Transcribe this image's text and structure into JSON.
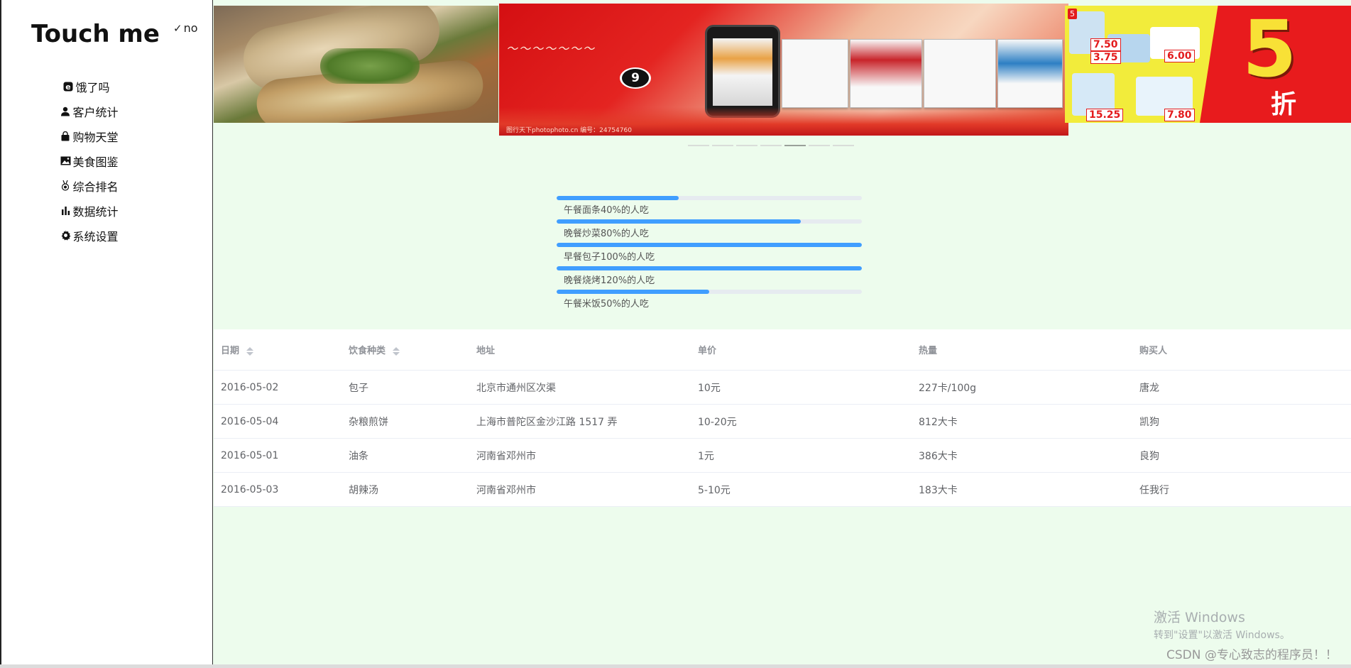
{
  "sidebar": {
    "title": "Touch me",
    "toggle_label": "no",
    "items": [
      {
        "label": "饿了吗",
        "icon": "eleme-icon"
      },
      {
        "label": "客户统计",
        "icon": "user-icon"
      },
      {
        "label": "购物天堂",
        "icon": "shopping-bag-icon"
      },
      {
        "label": "美食图鉴",
        "icon": "picture-icon"
      },
      {
        "label": "综合排名",
        "icon": "medal-icon"
      },
      {
        "label": "数据统计",
        "icon": "bar-chart-icon"
      },
      {
        "label": "系统设置",
        "icon": "gear-icon"
      }
    ]
  },
  "carousel": {
    "slide_count": 7,
    "active_index": 4,
    "center_caption": "图行天下photophoto.cn   编号：24754760",
    "center_badge": "9",
    "right_big": "5",
    "right_zhe": "折",
    "right_prices": [
      "7.50",
      "3.75",
      "6.00",
      "15.25",
      "7.80"
    ]
  },
  "progress": [
    {
      "label": "午餐面条40%的人吃",
      "percent": 40
    },
    {
      "label": "晚餐炒菜80%的人吃",
      "percent": 80
    },
    {
      "label": "早餐包子100%的人吃",
      "percent": 100
    },
    {
      "label": "晚餐烧烤120%的人吃",
      "percent": 100
    },
    {
      "label": "午餐米饭50%的人吃",
      "percent": 50
    }
  ],
  "table": {
    "headers": [
      "日期",
      "饮食种类",
      "地址",
      "单价",
      "热量",
      "购买人"
    ],
    "rows": [
      [
        "2016-05-02",
        "包子",
        "北京市通州区次渠",
        "10元",
        "227卡/100g",
        "唐龙"
      ],
      [
        "2016-05-04",
        "杂粮煎饼",
        "上海市普陀区金沙江路 1517 弄",
        "10-20元",
        "812大卡",
        "凯狗"
      ],
      [
        "2016-05-01",
        "油条",
        "河南省邓州市",
        "1元",
        "386大卡",
        "良狗"
      ],
      [
        "2016-05-03",
        "胡辣汤",
        "河南省邓州市",
        "5-10元",
        "183大卡",
        "任我行"
      ]
    ]
  },
  "watermark": {
    "activate_title": "激活 Windows",
    "activate_sub": "转到\"设置\"以激活 Windows。",
    "csdn": "CSDN @专心致志的程序员！！"
  },
  "colors": {
    "page_bg": "#edfced",
    "progress_fill": "#409eff",
    "progress_track": "#e6ebf0"
  }
}
